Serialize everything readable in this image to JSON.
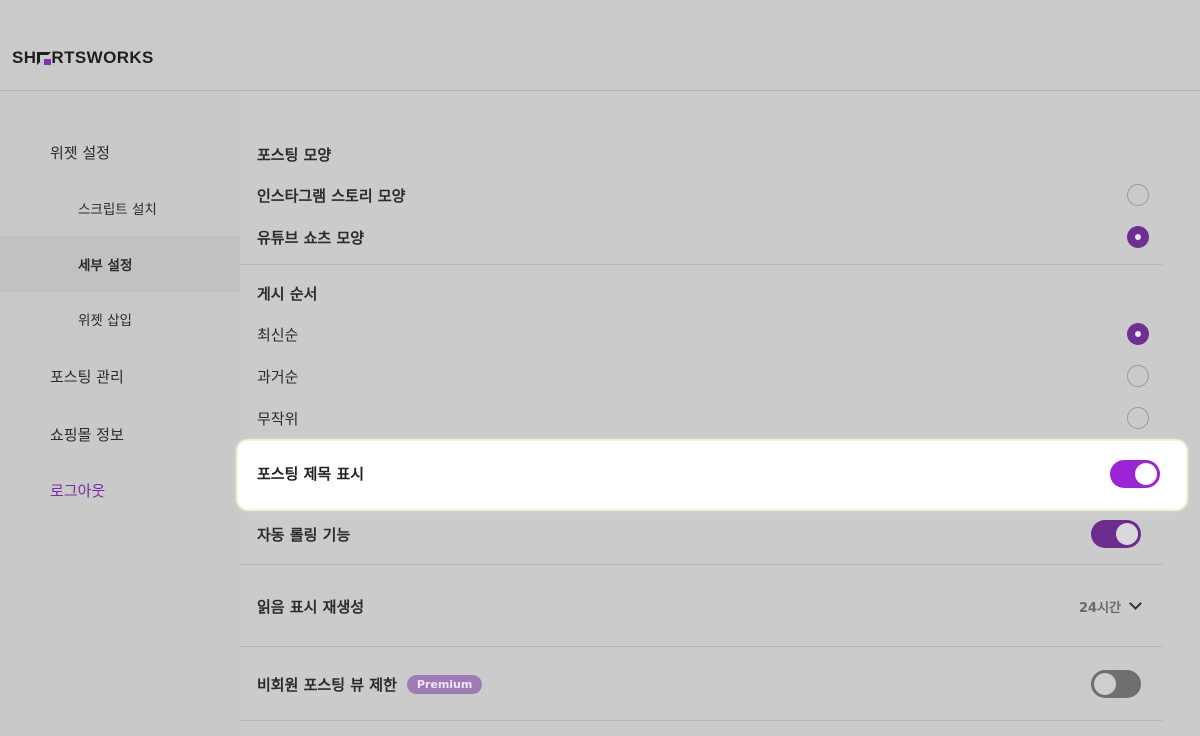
{
  "brand": {
    "logo_left": "SH",
    "logo_right": "RTSWORKS",
    "accent": "#8a2dbf"
  },
  "sidebar": {
    "items": [
      {
        "label": "위젯 설정"
      },
      {
        "label": "스크립트 설치"
      },
      {
        "label": "세부 설정"
      },
      {
        "label": "위젯 삽입"
      },
      {
        "label": "포스팅 관리"
      },
      {
        "label": "쇼핑몰 정보"
      },
      {
        "label": "로그아웃"
      }
    ]
  },
  "posting_shape": {
    "title": "포스팅 모양",
    "options": [
      {
        "label": "인스타그램 스토리 모양",
        "selected": false
      },
      {
        "label": "유튜브 쇼츠 모양",
        "selected": true
      }
    ]
  },
  "post_order": {
    "title": "게시 순서",
    "options": [
      {
        "label": "최신순",
        "selected": true
      },
      {
        "label": "과거순",
        "selected": false
      },
      {
        "label": "무작위",
        "selected": false
      }
    ]
  },
  "settings": {
    "show_title": {
      "label": "포스팅 제목 표시",
      "enabled": true
    },
    "auto_scroll": {
      "label": "자동 롤링 기능",
      "enabled": true
    },
    "read_regen": {
      "label": "읽음 표시 재생성",
      "value": "24시간"
    },
    "guest_limit": {
      "label": "비회원 포스팅 뷰 제한",
      "badge": "Premium",
      "enabled": false
    }
  },
  "colors": {
    "toggle_on": "#9b25d6",
    "radio_on": "#6f2e93",
    "badge": "#a07bb5"
  },
  "icons": {
    "dropdown": "chevron-down-icon"
  }
}
